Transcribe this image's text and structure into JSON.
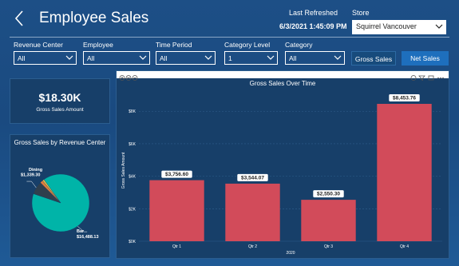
{
  "header": {
    "title": "Employee Sales",
    "refresh_label": "Last Refreshed",
    "refresh_value": "6/3/2021 1:45:09 PM",
    "store_label": "Store",
    "store_value": "Squirrel Vancouver"
  },
  "filters": [
    {
      "label": "Revenue Center",
      "value": "All"
    },
    {
      "label": "Employee",
      "value": "All"
    },
    {
      "label": "Time Period",
      "value": "All"
    },
    {
      "label": "Category Level",
      "value": "1"
    },
    {
      "label": "Category",
      "value": "All"
    }
  ],
  "buttons": {
    "gross": "Gross Sales",
    "net": "Net Sales"
  },
  "kpi": {
    "value": "$18.30K",
    "label": "Gross Sales Amount"
  },
  "pie": {
    "title": "Gross Sales by Revenue Center",
    "slices": [
      {
        "name": "Bar",
        "value": 16488.13,
        "value_label": "$16,488.13",
        "color": "#00b4a8"
      },
      {
        "name": "Dining",
        "value": 1339.3,
        "value_label": "$1,339.30",
        "color": "#2f3f4d"
      },
      {
        "name": "",
        "value": 300,
        "value_label": "",
        "color": "#e27a3a"
      },
      {
        "name": "",
        "value": 176,
        "value_label": "",
        "color": "#e8c547"
      }
    ]
  },
  "chart_data": {
    "type": "bar",
    "title": "Gross Sales Over Time",
    "xlabel": "2020",
    "ylabel": "Gross Sales Amount",
    "categories": [
      "Qtr 1",
      "Qtr 2",
      "Qtr 3",
      "Qtr 4"
    ],
    "values": [
      3756.6,
      3544.07,
      2550.3,
      8453.76
    ],
    "value_labels": [
      "$3,756.60",
      "$3,544.07",
      "$2,550.30",
      "$8,453.76"
    ],
    "yticks": [
      0,
      2000,
      4000,
      6000,
      8000
    ],
    "ytick_labels": [
      "$0K",
      "$2K",
      "$4K",
      "$6K",
      "$8K"
    ],
    "ylim": [
      0,
      8700
    ],
    "bar_color": "#d24b5a",
    "grid": true
  }
}
